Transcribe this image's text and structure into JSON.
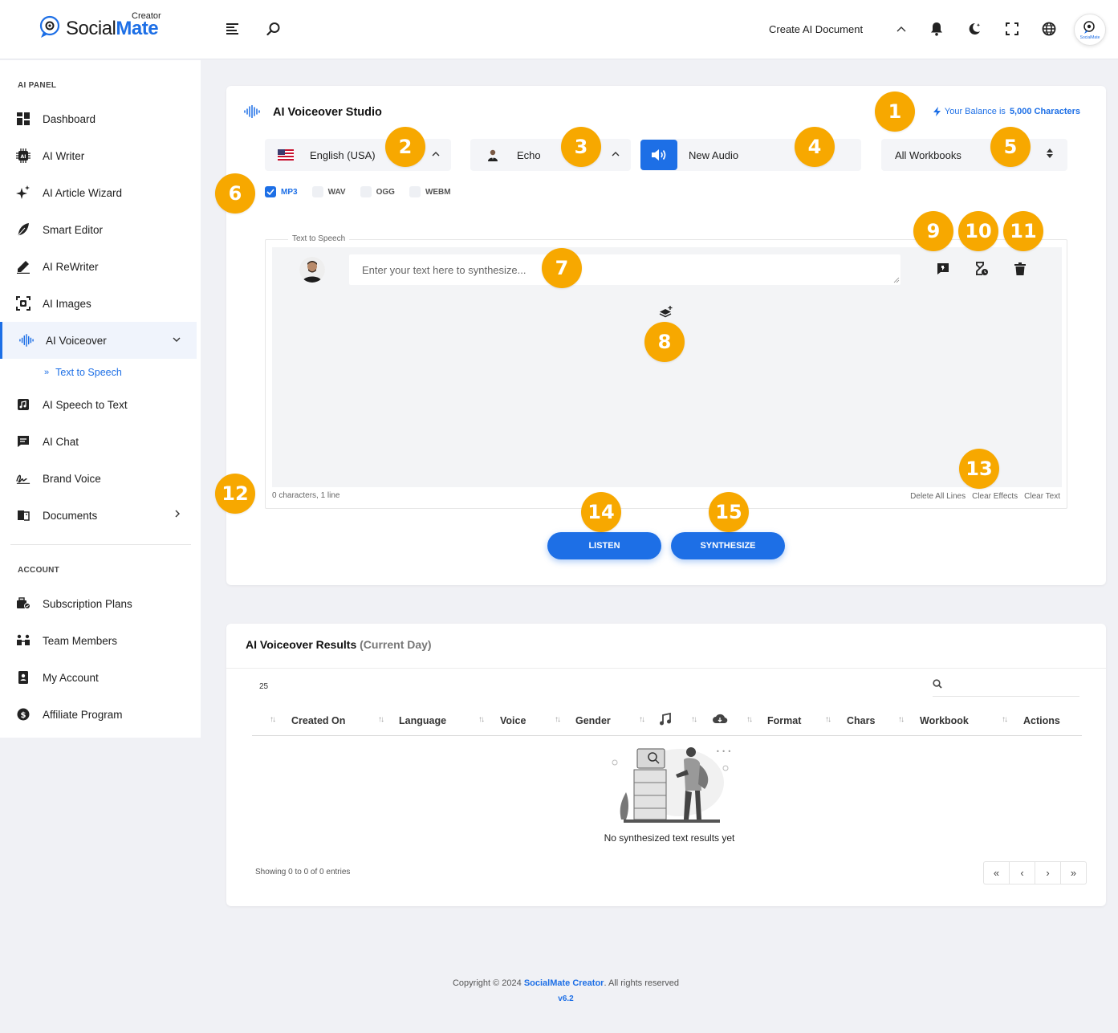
{
  "header": {
    "logo_text_a": "Social",
    "logo_text_b": "Mate",
    "logo_sup": "Creator",
    "create_doc": "Create AI Document",
    "avatar_caption": "SocialMate"
  },
  "sidebar": {
    "heading_panel": "AI PANEL",
    "heading_account": "ACCOUNT",
    "items": [
      {
        "label": "Dashboard"
      },
      {
        "label": "AI Writer"
      },
      {
        "label": "AI Article Wizard"
      },
      {
        "label": "Smart Editor"
      },
      {
        "label": "AI ReWriter"
      },
      {
        "label": "AI Images"
      },
      {
        "label": "AI Voiceover"
      },
      {
        "label": "AI Speech to Text"
      },
      {
        "label": "AI Chat"
      },
      {
        "label": "Brand Voice"
      },
      {
        "label": "Documents"
      }
    ],
    "sub_item": "Text to Speech",
    "account_items": [
      {
        "label": "Subscription Plans"
      },
      {
        "label": "Team Members"
      },
      {
        "label": "My Account"
      },
      {
        "label": "Affiliate Program"
      }
    ]
  },
  "studio": {
    "title": "AI Voiceover Studio",
    "balance_prefix": "Your Balance is",
    "balance_value": "5,000 Characters",
    "language": "English (USA)",
    "voice": "Echo",
    "audio_name": "New Audio",
    "workbook": "All Workbooks",
    "formats": [
      {
        "label": "MP3",
        "checked": true
      },
      {
        "label": "WAV",
        "checked": false
      },
      {
        "label": "OGG",
        "checked": false
      },
      {
        "label": "WEBM",
        "checked": false
      }
    ],
    "tts_legend": "Text to Speech",
    "tts_placeholder": "Enter your text here to synthesize...",
    "char_count": "0 characters, 1 line",
    "delete_all": "Delete All Lines",
    "clear_effects": "Clear Effects",
    "clear_text": "Clear Text",
    "listen": "LISTEN",
    "synthesize": "SYNTHESIZE"
  },
  "results": {
    "title": "AI Voiceover Results",
    "title_suffix": "(Current Day)",
    "page_length": "25",
    "columns": [
      "Created On",
      "Language",
      "Voice",
      "Gender",
      "Format",
      "Chars",
      "Workbook",
      "Actions"
    ],
    "empty_text": "No synthesized text results yet",
    "info": "Showing 0 to 0 of 0 entries",
    "pager": [
      "«",
      "‹",
      "›",
      "»"
    ]
  },
  "footer": {
    "copyright_prefix": "Copyright © 2024",
    "brand": "SocialMate Creator",
    "copyright_suffix": ". All rights reserved",
    "version": "v6.2"
  },
  "badges": [
    "1",
    "2",
    "3",
    "4",
    "5",
    "6",
    "7",
    "8",
    "9",
    "10",
    "11",
    "12",
    "13",
    "14",
    "15"
  ],
  "colors": {
    "accent": "#1d6fe6",
    "badge": "#f7a800",
    "background": "#f0f1f5"
  }
}
